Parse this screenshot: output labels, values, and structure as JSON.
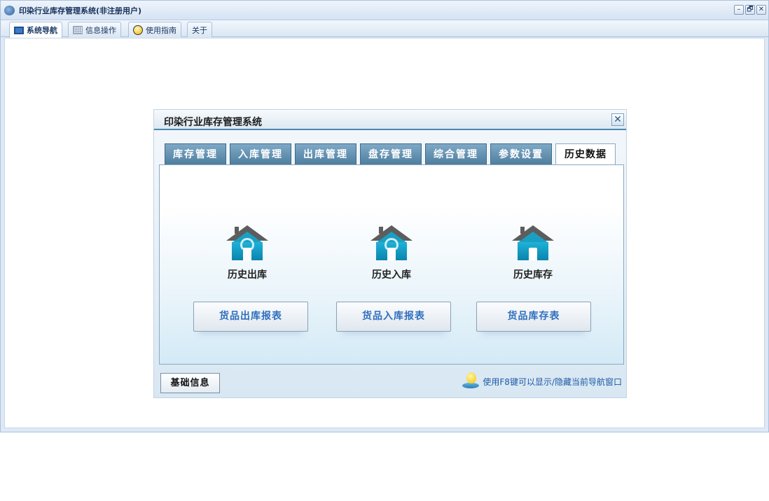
{
  "window": {
    "title": "印染行业库存管理系统(非注册用户)",
    "controls": {
      "minimize": "–",
      "restore": "🗗",
      "close": "✕"
    }
  },
  "toolbar": {
    "tabs": [
      {
        "label": "系统导航",
        "icon": "monitor-icon",
        "active": true
      },
      {
        "label": "信息操作",
        "icon": "grid-icon",
        "active": false
      },
      {
        "label": "使用指南",
        "icon": "help-icon",
        "active": false
      },
      {
        "label": "关于",
        "icon": "",
        "active": false
      }
    ]
  },
  "nav_dialog": {
    "title": "印染行业库存管理系统",
    "close_glyph": "✕",
    "tabs": [
      {
        "label": "库存管理",
        "active": false
      },
      {
        "label": "入库管理",
        "active": false
      },
      {
        "label": "出库管理",
        "active": false
      },
      {
        "label": "盘存管理",
        "active": false
      },
      {
        "label": "综合管理",
        "active": false
      },
      {
        "label": "参数设置",
        "active": false
      },
      {
        "label": "历史数据",
        "active": true
      }
    ],
    "features": [
      {
        "label": "历史出库",
        "icon": "house-out-icon"
      },
      {
        "label": "历史入库",
        "icon": "house-in-icon"
      },
      {
        "label": "历史库存",
        "icon": "house-icon"
      }
    ],
    "reports": [
      {
        "label": "货品出库报表"
      },
      {
        "label": "货品入库报表"
      },
      {
        "label": "货品库存表"
      }
    ],
    "base_button": "基础信息",
    "hint": "使用F8键可以显示/隐藏当前导航窗口"
  },
  "colors": {
    "accent": "#4f7e9f",
    "link": "#2f6fbe",
    "house": "#1a9fc3"
  }
}
